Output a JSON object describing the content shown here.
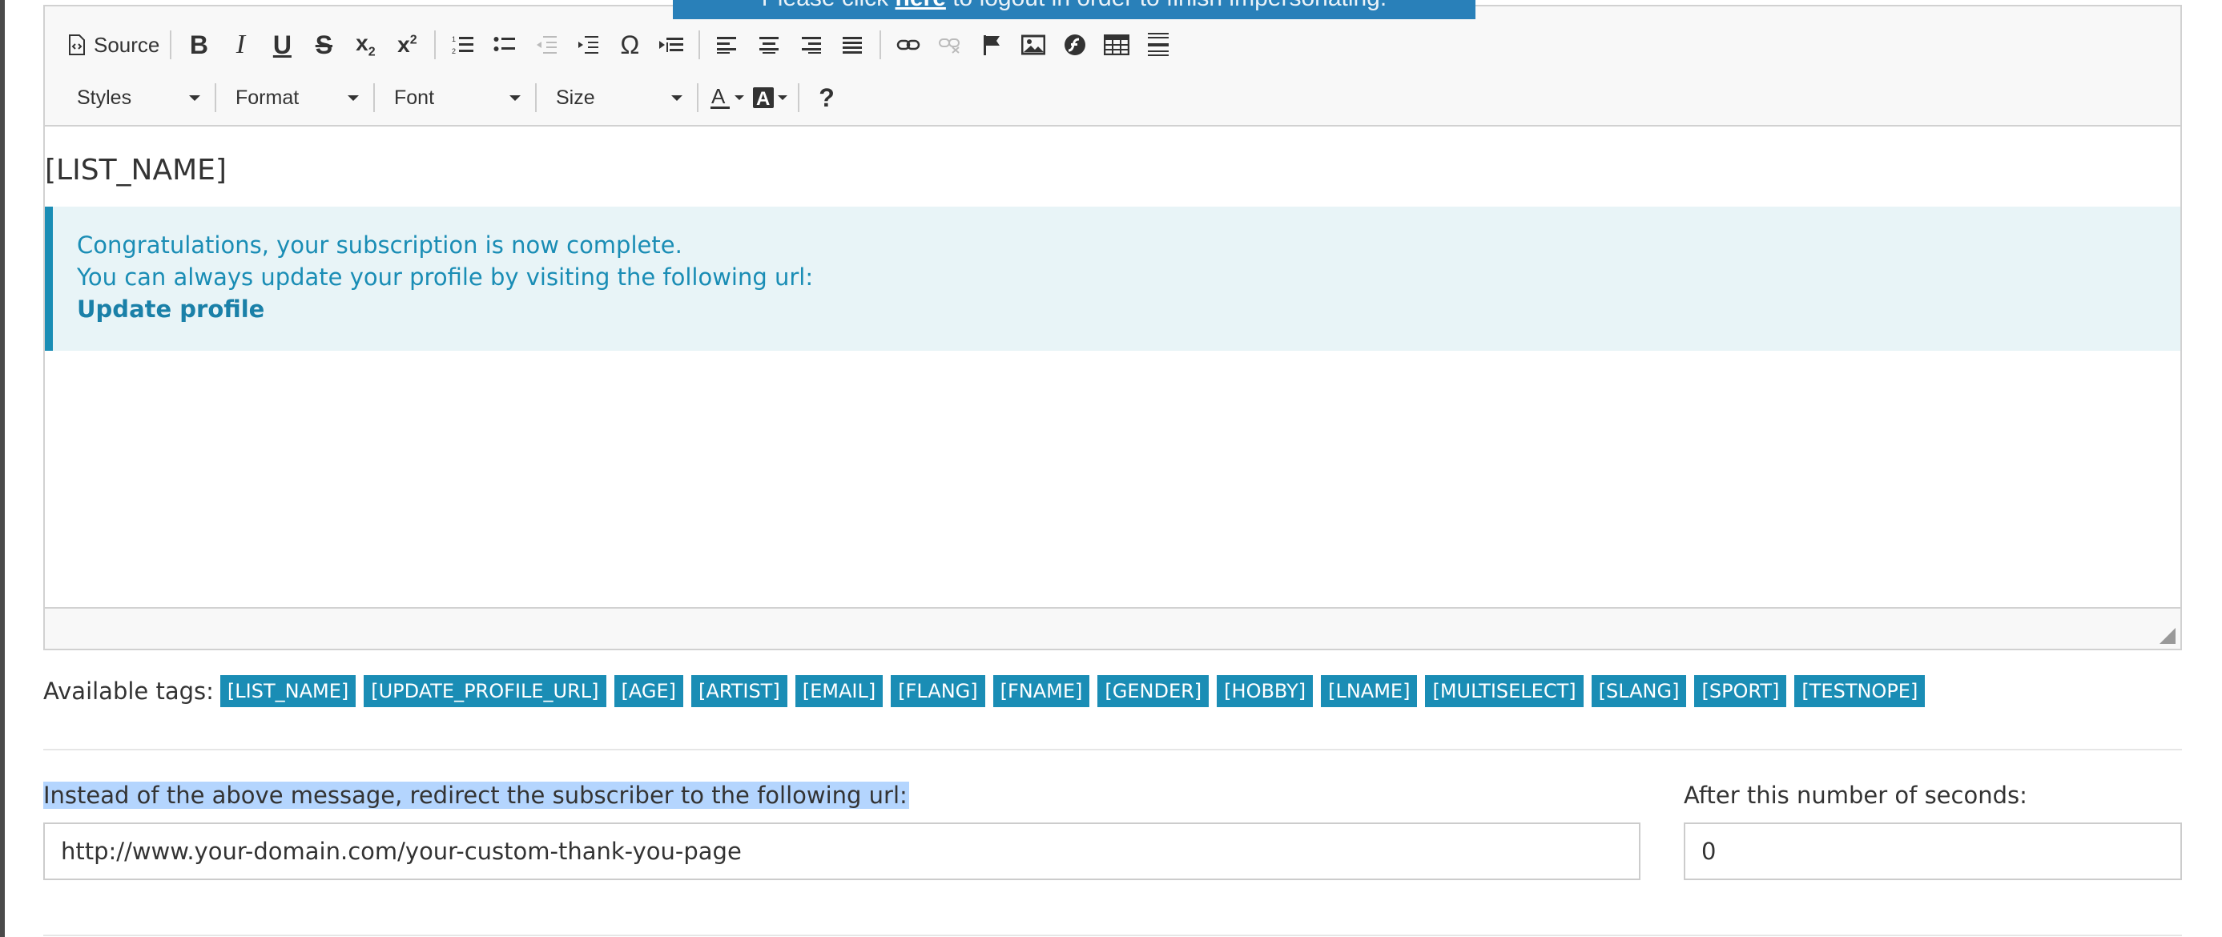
{
  "banner": {
    "text_before": "Please click ",
    "link": "here",
    "text_after": " to logout in order to finish impersonating."
  },
  "toolbar": {
    "source_label": "Source",
    "styles_label": "Styles",
    "format_label": "Format",
    "font_label": "Font",
    "size_label": "Size",
    "help_label": "?",
    "omega_symbol": "Ω",
    "icons": [
      "source-icon",
      "bold-icon",
      "italic-icon",
      "underline-icon",
      "strikethrough-icon",
      "subscript-icon",
      "superscript-icon",
      "numbered-list-icon",
      "bulleted-list-icon",
      "outdent-icon",
      "indent-icon",
      "special-character-icon",
      "blockquote-icon",
      "align-left-icon",
      "align-center-icon",
      "align-right-icon",
      "justify-icon",
      "link-icon",
      "unlink-icon",
      "anchor-flag-icon",
      "image-icon",
      "flash-icon",
      "table-icon",
      "horizontal-line-icon",
      "text-color-icon",
      "background-color-icon",
      "help-icon"
    ]
  },
  "editor": {
    "heading": "[LIST_NAME]",
    "callout": {
      "line1": "Congratulations, your subscription is now complete.",
      "line2": "You can always update your profile by visiting the following url:",
      "link": "Update profile",
      "accent_color": "#1a8db5",
      "background_color": "#e8f4f7"
    }
  },
  "tags": {
    "label": "Available tags:",
    "items": [
      "[LIST_NAME]",
      "[UPDATE_PROFILE_URL]",
      "[AGE]",
      "[ARTIST]",
      "[EMAIL]",
      "[FLANG]",
      "[FNAME]",
      "[GENDER]",
      "[HOBBY]",
      "[LNAME]",
      "[MULTISELECT]",
      "[SLANG]",
      "[SPORT]",
      "[TESTNOPE]"
    ],
    "color": "#1a8db5"
  },
  "redirect": {
    "label": "Instead of the above message, redirect the subscriber to the following url:",
    "url_value": "http://www.your-domain.com/your-custom-thank-you-page",
    "seconds_label": "After this number of seconds:",
    "seconds_value": "0"
  }
}
